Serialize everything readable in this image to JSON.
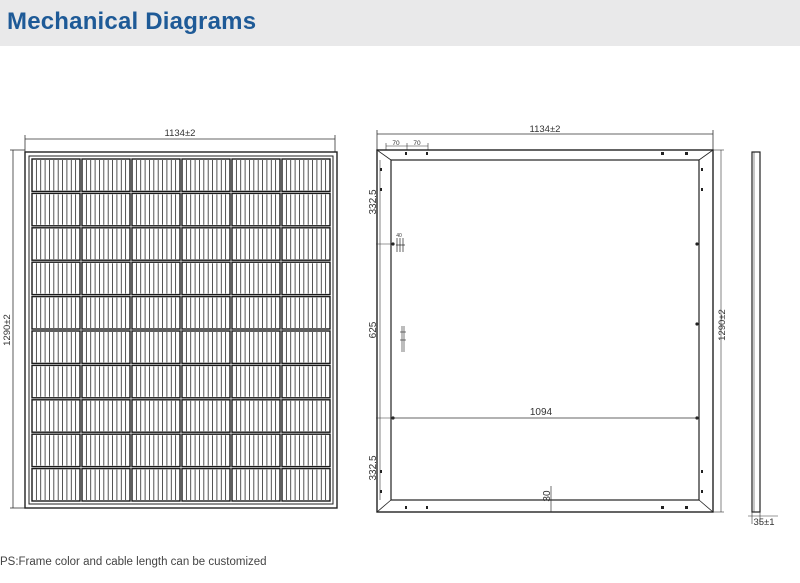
{
  "header": {
    "title": "Mechanical Diagrams"
  },
  "front_view": {
    "width_label": "1134±2",
    "height_label": "1290±2",
    "cell_rows": 10,
    "cell_cols": 6,
    "busbars_per_cell": 5
  },
  "back_view": {
    "width_label": "1134±2",
    "height_label": "1290±2",
    "hole_spacing_left": "70",
    "hole_spacing_right": "70",
    "dim_top": "332.5",
    "dim_middle": "625",
    "dim_bottom": "332.5",
    "inner_width": "1094",
    "rail_width": "30",
    "small_mark": "40"
  },
  "side_view": {
    "thickness_label": "35±1"
  },
  "footnote": "PS:Frame color and cable length can be customized",
  "colors": {
    "title": "#1e5a97",
    "header_bg": "#e9e9ea",
    "line": "#222222"
  }
}
